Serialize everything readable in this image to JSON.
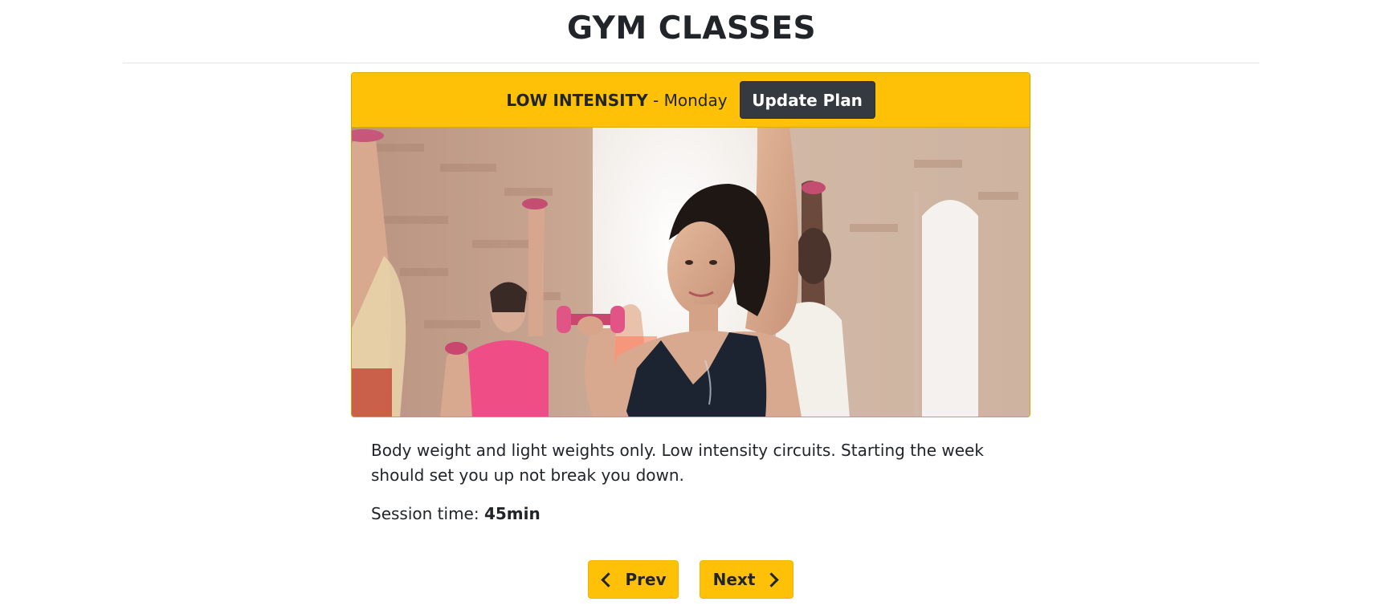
{
  "page": {
    "title": "GYM CLASSES"
  },
  "card": {
    "intensity": "LOW INTENSITY",
    "separator": " - ",
    "day": "Monday",
    "update_button": "Update Plan",
    "image_alt": "Woman lifting pink dumbbells in a fitness class"
  },
  "details": {
    "description": "Body weight and light weights only. Low intensity circuits. Starting the week should set you up not break you down.",
    "session_label": "Session time: ",
    "session_value": "45min"
  },
  "nav": {
    "prev_label": "Prev",
    "next_label": "Next"
  },
  "colors": {
    "accent": "#ffc107",
    "dark_button": "#343a40",
    "text": "#212529"
  }
}
